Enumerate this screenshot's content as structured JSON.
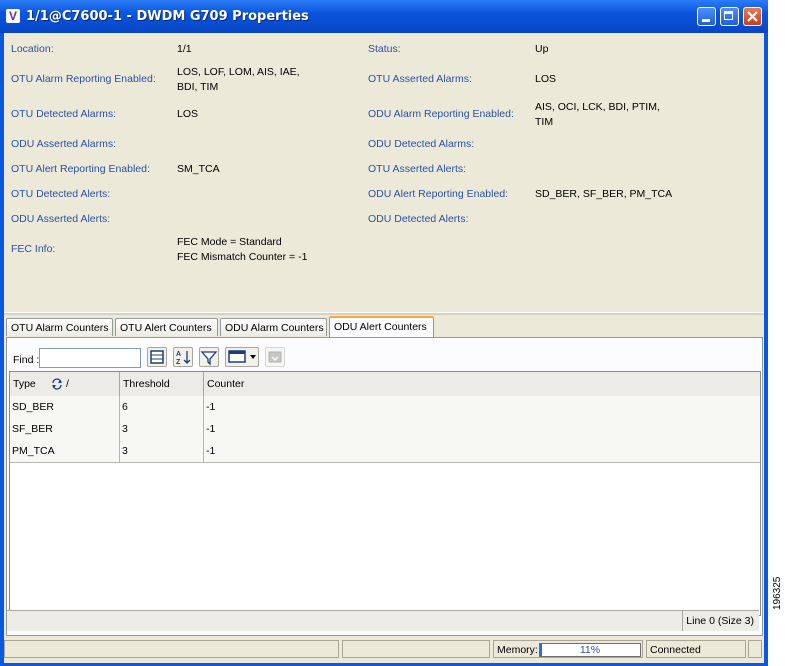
{
  "window": {
    "title": "1/1@C7600-1 - DWDM G709 Properties",
    "app_icon_letter": "V",
    "accent_color": "#0a58e0",
    "label_color": "#2a51a5"
  },
  "properties": {
    "location_label": "Location:",
    "location_value": "1/1",
    "status_label": "Status:",
    "status_value": "Up",
    "otu_alarm_reporting_label": "OTU Alarm Reporting Enabled:",
    "otu_alarm_reporting_value_1": "LOS, LOF, LOM, AIS, IAE,",
    "otu_alarm_reporting_value_2": "BDI, TIM",
    "otu_asserted_alarms_label": "OTU Asserted Alarms:",
    "otu_asserted_alarms_value": "LOS",
    "otu_detected_alarms_label": "OTU Detected Alarms:",
    "otu_detected_alarms_value": "LOS",
    "odu_alarm_reporting_label": "ODU Alarm Reporting Enabled:",
    "odu_alarm_reporting_value_1": "AIS, OCI, LCK, BDI, PTIM,",
    "odu_alarm_reporting_value_2": "TIM",
    "odu_asserted_alarms_label": "ODU Asserted Alarms:",
    "odu_detected_alarms_label": "ODU Detected Alarms:",
    "otu_alert_reporting_label": "OTU Alert Reporting Enabled:",
    "otu_alert_reporting_value": "SM_TCA",
    "otu_asserted_alerts_label": "OTU Asserted Alerts:",
    "otu_detected_alerts_label": "OTU Detected Alerts:",
    "odu_alert_reporting_label": "ODU Alert Reporting Enabled:",
    "odu_alert_reporting_value": "SD_BER, SF_BER, PM_TCA",
    "odu_asserted_alerts_label": "ODU Asserted Alerts:",
    "odu_detected_alerts_label": "ODU Detected Alerts:",
    "fec_info_label": "FEC Info:",
    "fec_info_value_1": "FEC Mode = Standard",
    "fec_info_value_2": "FEC Mismatch Counter = -1"
  },
  "tabs": [
    "OTU Alarm Counters",
    "OTU Alert Counters",
    "ODU Alarm Counters",
    "ODU Alert Counters"
  ],
  "active_tab": "ODU Alert Counters",
  "toolbar": {
    "find_label": "Find :",
    "find_value": "",
    "icons": [
      "table-view-icon",
      "sort-az-icon",
      "filter-icon",
      "columns-dropdown-icon",
      "export-icon"
    ]
  },
  "table": {
    "columns": [
      "Type",
      "Threshold",
      "Counter"
    ],
    "sort_indicator": "/",
    "rows": [
      [
        "SD_BER",
        "6",
        "-1"
      ],
      [
        "SF_BER",
        "3",
        "-1"
      ],
      [
        "PM_TCA",
        "3",
        "-1"
      ]
    ],
    "footer": "Line 0 (Size 3)"
  },
  "statusbar": {
    "memory_label": "Memory:",
    "memory_percent": 11,
    "memory_text": "11%",
    "connection": "Connected"
  },
  "side_label": "196325"
}
